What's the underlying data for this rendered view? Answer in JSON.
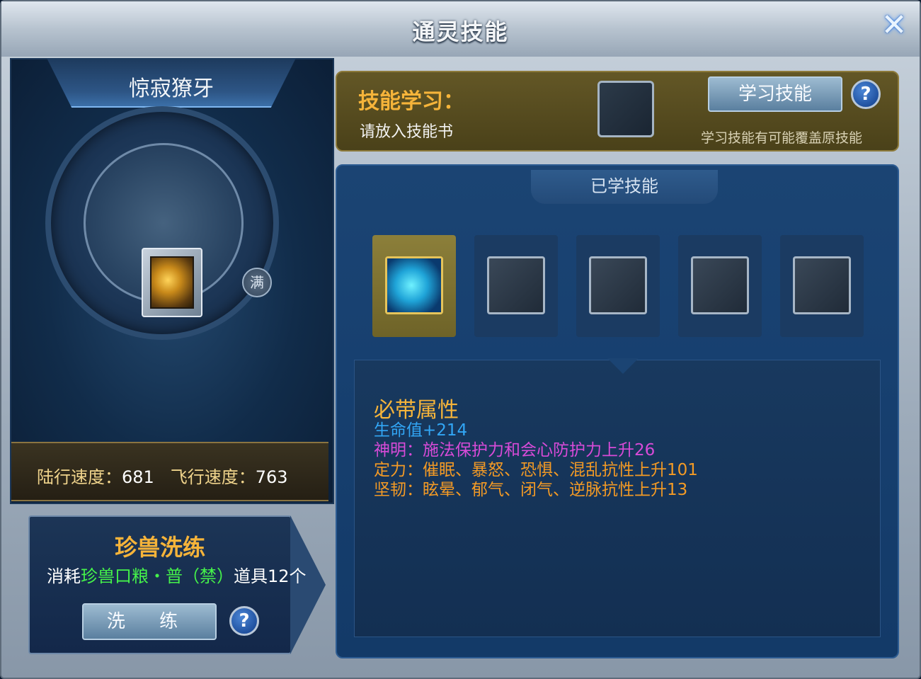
{
  "window": {
    "title": "通灵技能",
    "close_icon": "✕"
  },
  "pet": {
    "name": "惊寂獠牙",
    "full_badge": "满",
    "speed": {
      "land_label": "陆行速度：",
      "land_value": "681",
      "fly_label": "飞行速度：",
      "fly_value": "763"
    }
  },
  "wash": {
    "title": "珍兽洗练",
    "cost_prefix": "消耗",
    "cost_item": "珍兽口粮・普（禁）",
    "cost_suffix": "道具12个",
    "button_label": "洗 练",
    "help_label": "?"
  },
  "learn": {
    "title": "技能学习：",
    "hint": "请放入技能书",
    "button_label": "学习技能",
    "help_label": "?",
    "warning": "学习技能有可能覆盖原技能"
  },
  "learned": {
    "tab_label": "已学技能",
    "slots": [
      {
        "state": "filled",
        "icon": "horse-icon"
      },
      {
        "state": "empty",
        "icon": "book-icon"
      },
      {
        "state": "empty",
        "icon": "book-icon"
      },
      {
        "state": "empty",
        "icon": "book-icon"
      },
      {
        "state": "empty",
        "icon": "book-icon"
      }
    ]
  },
  "description": {
    "title": "必带属性",
    "lines": [
      {
        "text": "生命值+214",
        "color": "#32a6f5"
      },
      {
        "text": "神明：施法保护力和会心防护力上升26",
        "color": "#d84bd8"
      },
      {
        "text": "定力：催眠、暴怒、恐惧、混乱抗性上升101",
        "color": "#f39a25"
      },
      {
        "text": "坚韧：眩晕、郁气、闭气、逆脉抗性上升13",
        "color": "#f39a25"
      }
    ]
  }
}
